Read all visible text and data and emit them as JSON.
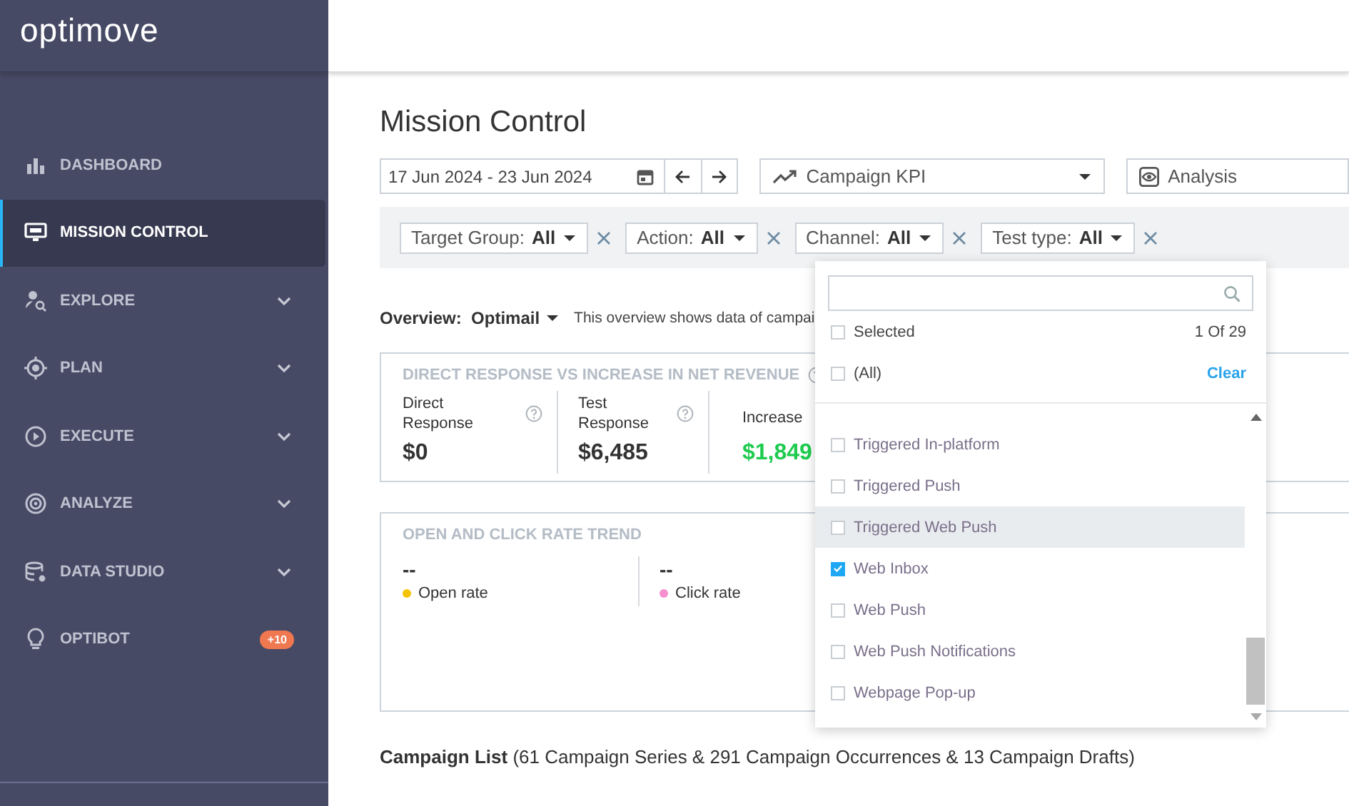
{
  "sidebar": {
    "logo": "optimove",
    "items": [
      {
        "kind": "dashboard",
        "label": "DASHBOARD",
        "selected": false,
        "expandable": false
      },
      {
        "kind": "monitor",
        "label": "MISSION CONTROL",
        "selected": true,
        "expandable": false
      },
      {
        "kind": "explore",
        "label": "EXPLORE",
        "selected": false,
        "expandable": true
      },
      {
        "kind": "plan",
        "label": "PLAN",
        "selected": false,
        "expandable": true
      },
      {
        "kind": "execute",
        "label": "EXECUTE",
        "selected": false,
        "expandable": true
      },
      {
        "kind": "analyze",
        "label": "ANALYZE",
        "selected": false,
        "expandable": true
      },
      {
        "kind": "data",
        "label": "DATA STUDIO",
        "selected": false,
        "expandable": true
      },
      {
        "kind": "bulb",
        "label": "OPTIBOT",
        "selected": false,
        "expandable": false,
        "badge": "+10"
      }
    ]
  },
  "page": {
    "title": "Mission Control",
    "toolbar": {
      "date_range": "17 Jun 2024 - 23 Jun 2024",
      "kpi": "Campaign KPI",
      "view": "Analysis"
    },
    "filters": [
      {
        "label": "Target Group:",
        "value": "All"
      },
      {
        "label": "Action:",
        "value": "All"
      },
      {
        "label": "Channel:",
        "value": "All"
      },
      {
        "label": "Test type:",
        "value": "All"
      }
    ],
    "overview": {
      "label": "Overview:",
      "value": "Optimail",
      "note": "This overview shows data of campai"
    },
    "response_card": {
      "title": "DIRECT RESPONSE VS INCREASE IN NET REVENUE",
      "metrics": [
        {
          "label": "Direct Response",
          "value": "$0",
          "help": true,
          "positive": false
        },
        {
          "label": "Test Response",
          "value": "$6,485",
          "help": true,
          "positive": false
        },
        {
          "label": "Increase",
          "value": "$1,849",
          "help": false,
          "positive": true
        }
      ]
    },
    "trend_card": {
      "title": "OPEN AND CLICK RATE TREND",
      "metrics": [
        {
          "value": "--",
          "label": "Open rate",
          "color": "#f5c400"
        },
        {
          "value": "--",
          "label": "Click rate",
          "color": "#f58fd0"
        }
      ]
    },
    "campaign_list": {
      "title": "Campaign List",
      "summary": "(61 Campaign Series & 291 Campaign Occurrences & 13 Campaign Drafts)"
    }
  },
  "channel_dropdown": {
    "selected_checked": false,
    "all_checked": false,
    "selected_label": "Selected",
    "selected_count": "1 Of 29",
    "all_label": "(All)",
    "clear": "Clear",
    "options": [
      {
        "label": "Triggered In-platform",
        "checked": false,
        "highlighted": false
      },
      {
        "label": "Triggered Push",
        "checked": false,
        "highlighted": false
      },
      {
        "label": "Triggered Web Push",
        "checked": false,
        "highlighted": true
      },
      {
        "label": "Web Inbox",
        "checked": true,
        "highlighted": false
      },
      {
        "label": "Web Push",
        "checked": false,
        "highlighted": false
      },
      {
        "label": "Web Push Notifications",
        "checked": false,
        "highlighted": false
      },
      {
        "label": "Webpage Pop-up",
        "checked": false,
        "highlighted": false
      }
    ]
  }
}
